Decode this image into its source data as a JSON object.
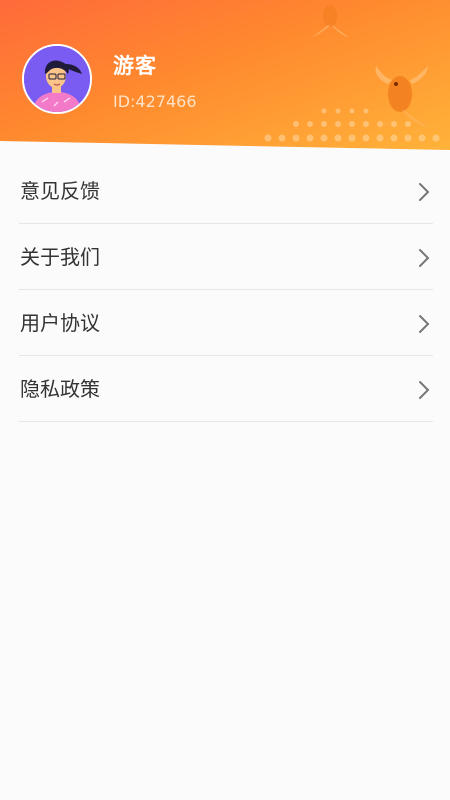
{
  "user": {
    "name": "游客",
    "id_text": "ID:427466"
  },
  "menu": {
    "items": [
      {
        "label": "意见反馈",
        "icon": "chevron-right-icon"
      },
      {
        "label": "关于我们",
        "icon": "chevron-right-icon"
      },
      {
        "label": "用户协议",
        "icon": "chevron-right-icon"
      },
      {
        "label": "隐私政策",
        "icon": "chevron-right-icon"
      }
    ]
  },
  "colors": {
    "header_start": "#ff6a3a",
    "header_end": "#ffb33a",
    "avatar_bg": "#7a5cf2",
    "text_primary": "#333333",
    "divider": "#e6e6e6"
  }
}
